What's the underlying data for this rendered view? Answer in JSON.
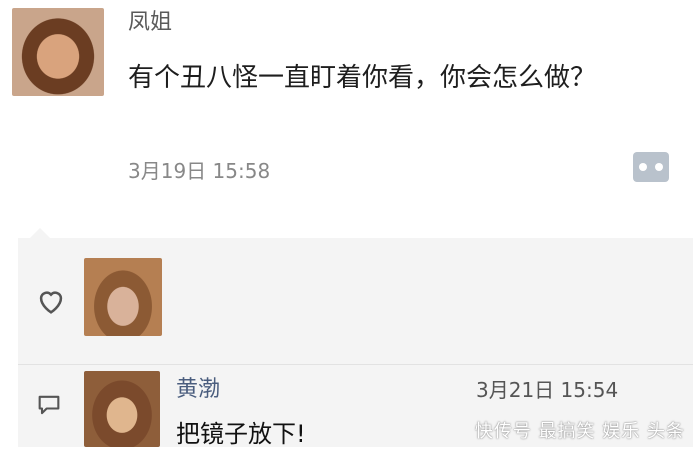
{
  "post": {
    "author": "凤姐",
    "text": "有个丑八怪一直盯着你看，你会怎么做？",
    "time": "3月19日 15:58",
    "more_icon": "more-dots-icon"
  },
  "likes": {
    "icon": "heart-icon"
  },
  "comments": [
    {
      "author": "黄渤",
      "time": "3月21日 15:54",
      "text": "把镜子放下!",
      "icon": "comment-icon"
    }
  ],
  "watermark": "快传号 最搞笑 娱乐 头条"
}
